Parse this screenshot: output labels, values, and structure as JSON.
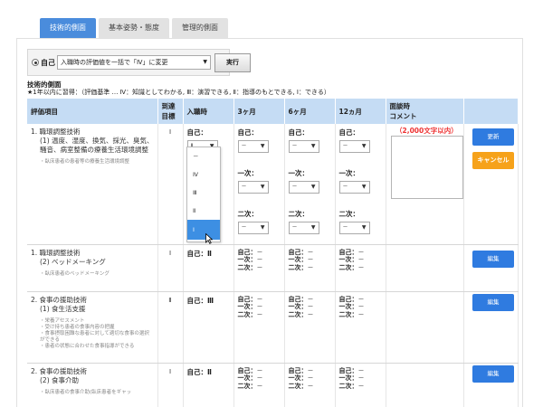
{
  "tabs": [
    {
      "label": "技術的側面"
    },
    {
      "label": "基本姿勢・態度"
    },
    {
      "label": "管理的側面"
    }
  ],
  "bulk": {
    "radio_label": "自己",
    "select_value": "入職時の評価値を一括で「Ⅳ」に変更",
    "run_label": "実行"
  },
  "section": {
    "title": "技術的側面",
    "note": "★1年以内に習得：（評価基準 … Ⅳ：知識としてわかる, Ⅲ：演習できる, Ⅱ：指導のもとできる, Ⅰ：できる）"
  },
  "table": {
    "headers": {
      "item": "評価項目",
      "goal": "到達\n目標",
      "entry": "入職時",
      "m3": "3ヶ月",
      "m6": "6ヶ月",
      "m12": "12ヵ月",
      "comment": "面談時\nコメント"
    },
    "labels": {
      "self": "自己：",
      "first": "一次：",
      "second": "二次：",
      "dash": "－"
    },
    "rows": [
      {
        "num": "1. 職環調整技術",
        "sub": "(1) 温度、湿度、換気、採光、臭気、騒音、病室整備の療養生活環境調整",
        "desc": "・臥床患者の患者等の療養生活環境調整",
        "goal": "Ⅰ",
        "entry_value": "Ⅱ",
        "edit_label": "更新",
        "cancel_label": "キャンセル",
        "comment_limit": "（2,000文字以内）"
      },
      {
        "num": "1. 職環調整技術",
        "sub": "(2) ベッドメーキング",
        "desc": "・臥床患者のベッドメーキング",
        "goal": "Ⅰ",
        "entry_value": "自己：Ⅱ",
        "edit_label": "編集"
      },
      {
        "num": "2. 食事の援助技術",
        "sub": "(1) 食生活支援",
        "desc": "・栄養アセスメント\n・受け持ち患者の食事内容の把握\n・食事摂取困難な患者に対して適切な食事の選択ができる\n・患者の状態に合わせた食事指導ができる",
        "goal": "Ⅱ",
        "entry_value": "自己：Ⅲ",
        "edit_label": "編集"
      },
      {
        "num": "2. 食事の援助技術",
        "sub": "(2) 食事介助",
        "desc": "・臥床患者の食事介助(臥床患者をギャッ",
        "goal": "Ⅰ",
        "entry_value": "自己：Ⅱ",
        "edit_label": "編集"
      }
    ]
  },
  "dropdown": {
    "options": [
      "－",
      "Ⅳ",
      "Ⅲ",
      "Ⅱ",
      "Ⅰ"
    ],
    "highlighted": "Ⅰ"
  },
  "colors": {
    "tab_active": "#4a8cdc",
    "header_bg": "#c5dcf4",
    "button_blue": "#2f7be0",
    "button_orange": "#f6a21a",
    "limit_text": "#e33333"
  }
}
